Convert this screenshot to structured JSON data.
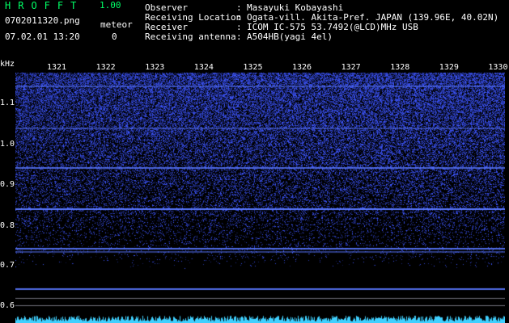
{
  "app": {
    "title": "HROFFT",
    "version": "1.00",
    "file_name": "0702011320.png",
    "timestamp": "07.02.01 13:20",
    "meteor_label": "meteor",
    "meteor_count": "0"
  },
  "info": [
    {
      "key": "Observer",
      "value": "Masayuki Kobayashi"
    },
    {
      "key": "Receiving Location",
      "value": "Ogata-vill. Akita-Pref. JAPAN (139.96E, 40.02N)"
    },
    {
      "key": "Receiver",
      "value": "ICOM IC-575 53.7492(@LCD)MHz USB"
    },
    {
      "key": "Receiving antenna",
      "value": "A504HB(yagi 4el)"
    }
  ],
  "spectrogram": {
    "y_unit": "kHz",
    "y_ticks": [
      "1.1",
      "1.0",
      "0.9",
      "0.8",
      "0.7",
      "0.6"
    ],
    "x_ticks": [
      "1321",
      "1322",
      "1323",
      "1324",
      "1325",
      "1326",
      "1327",
      "1328",
      "1329",
      "1330"
    ],
    "colors": {
      "background": "#000000",
      "noise": "#2a3fd6",
      "signal_line": "#4f6bff",
      "trace": "#3fd0ff",
      "header_accent": "#00ff66"
    }
  }
}
